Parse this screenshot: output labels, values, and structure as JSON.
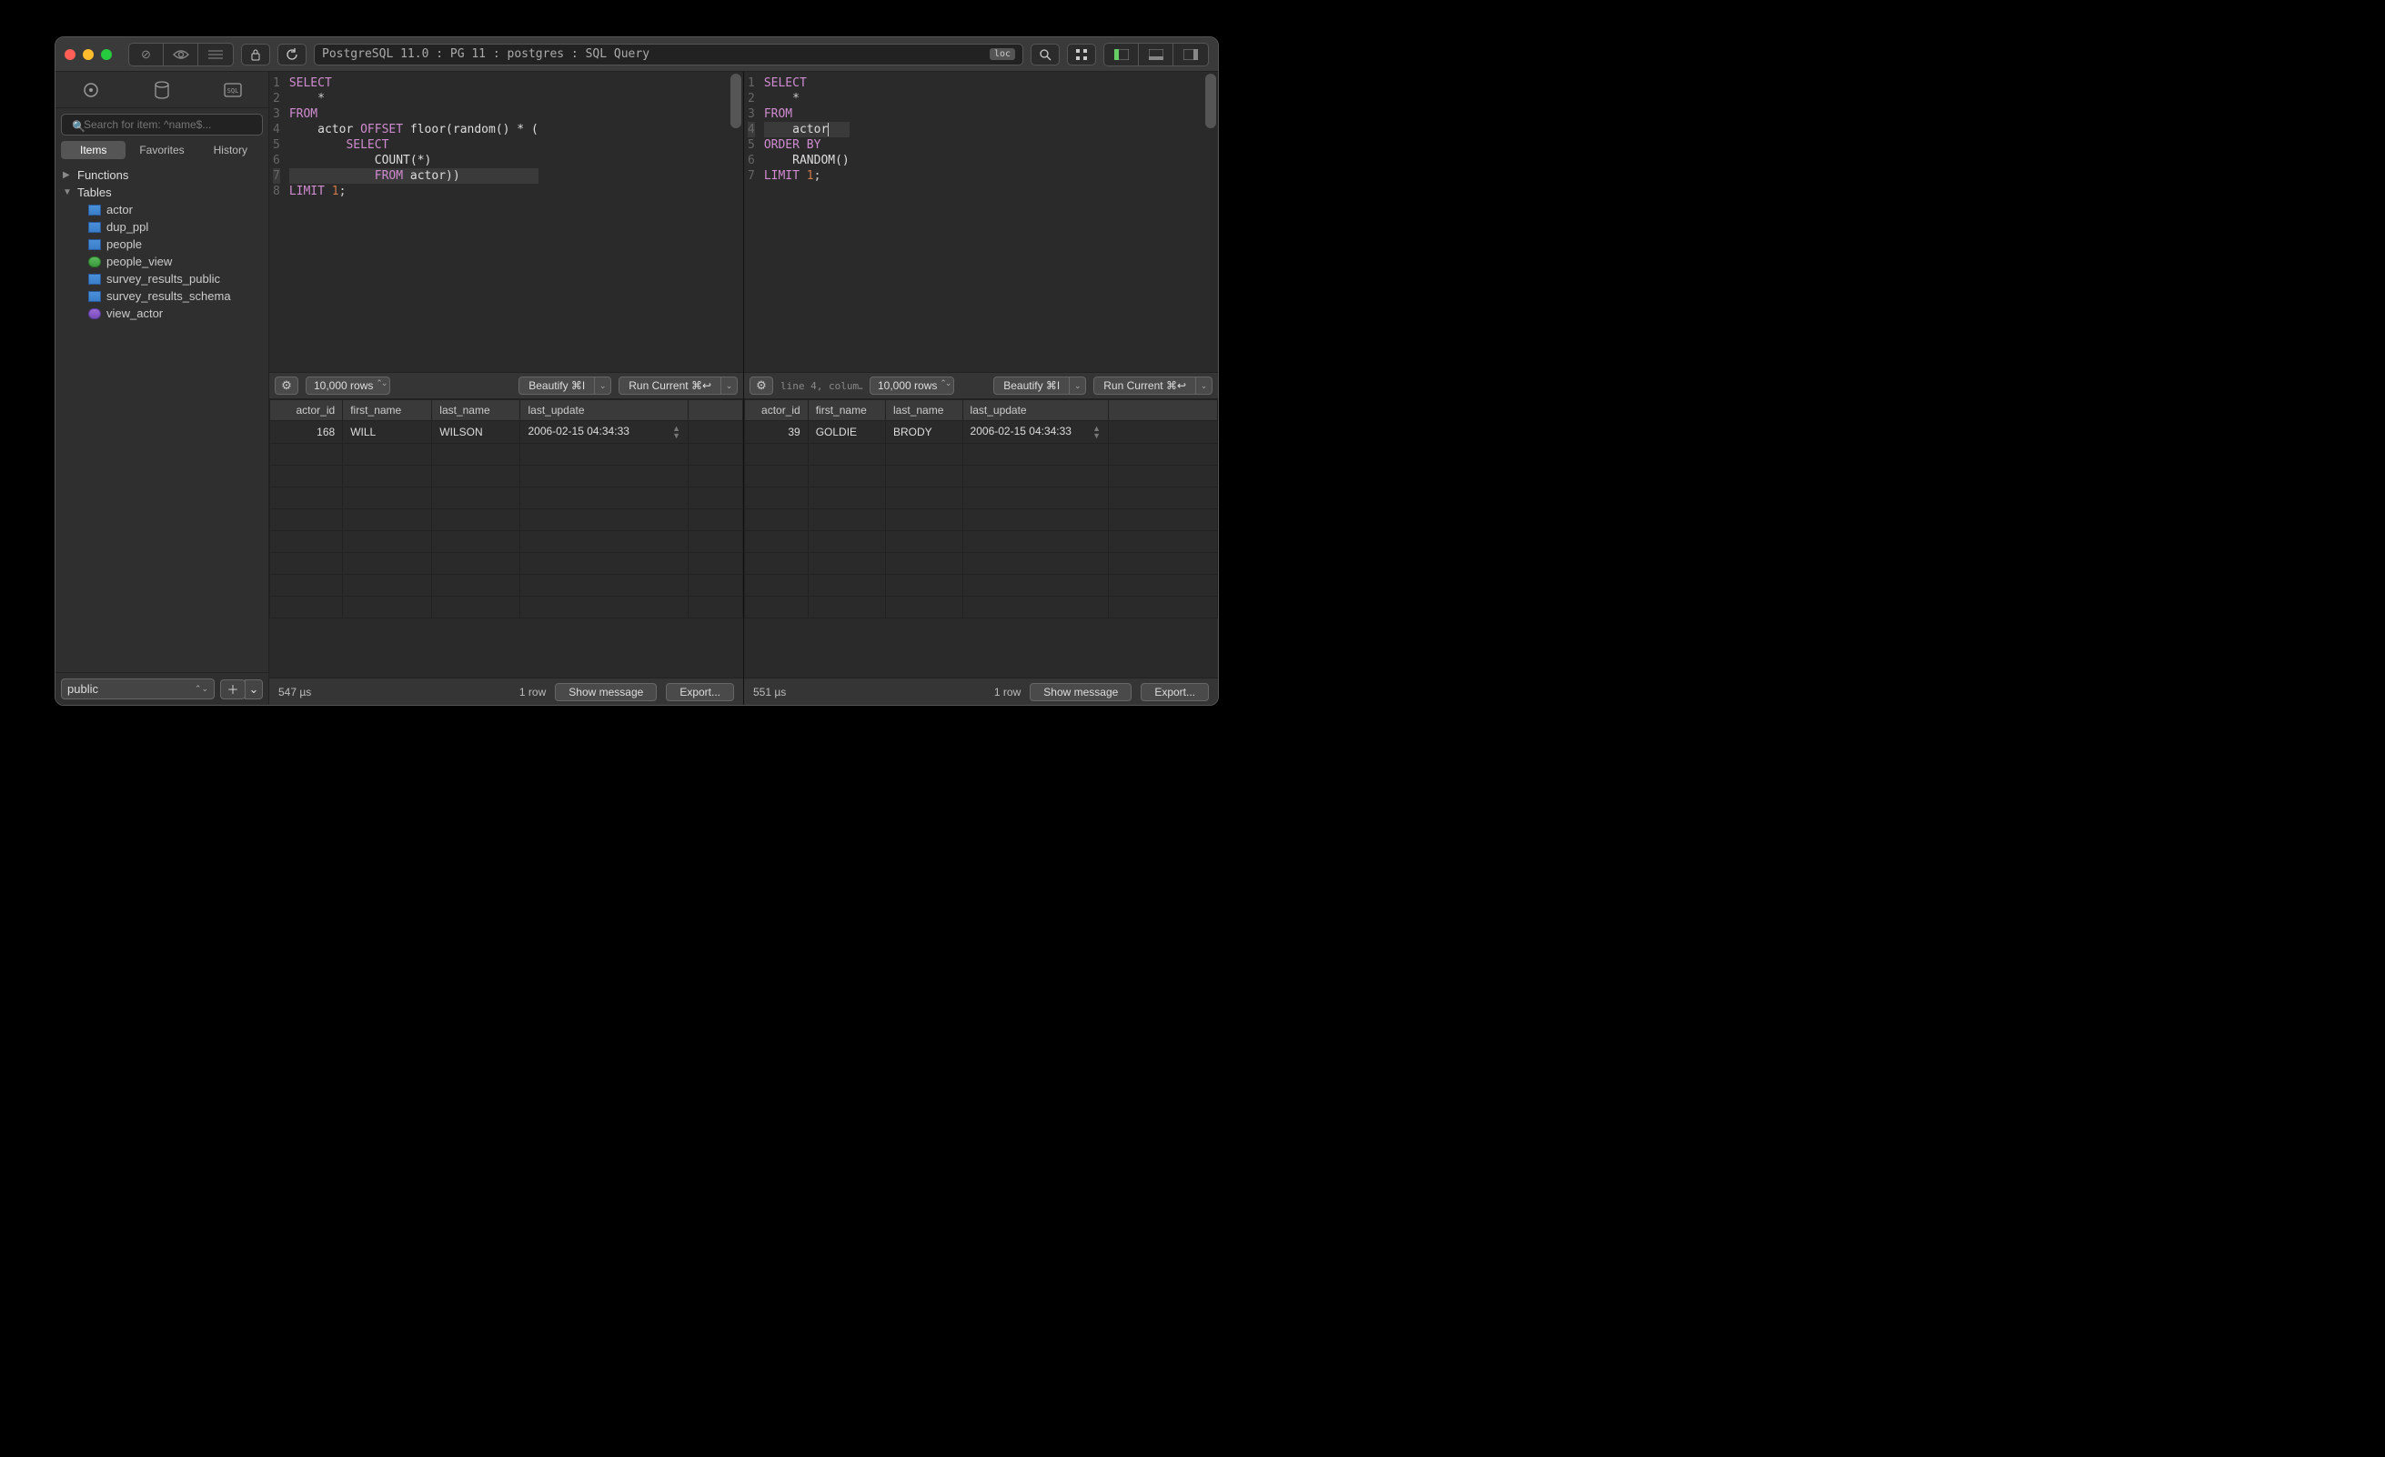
{
  "titlebar": {
    "path": "PostgreSQL 11.0 : PG 11 : postgres : SQL Query",
    "loc_badge": "loc"
  },
  "sidebar": {
    "search_placeholder": "Search for item: ^name$...",
    "tabs": {
      "items": "Items",
      "favorites": "Favorites",
      "history": "History"
    },
    "functions_label": "Functions",
    "tables_label": "Tables",
    "tables": [
      {
        "name": "actor",
        "kind": "blue"
      },
      {
        "name": "dup_ppl",
        "kind": "blue"
      },
      {
        "name": "people",
        "kind": "blue"
      },
      {
        "name": "people_view",
        "kind": "green"
      },
      {
        "name": "survey_results_public",
        "kind": "blue"
      },
      {
        "name": "survey_results_schema",
        "kind": "blue"
      },
      {
        "name": "view_actor",
        "kind": "purple"
      }
    ],
    "schema": "public"
  },
  "left_pane": {
    "rows_limit": "10,000 rows",
    "beautify": "Beautify ⌘I",
    "run": "Run Current ⌘↩",
    "columns": [
      "actor_id",
      "first_name",
      "last_name",
      "last_update"
    ],
    "row": {
      "actor_id": "168",
      "first_name": "WILL",
      "last_name": "WILSON",
      "last_update": "2006-02-15 04:34:33"
    },
    "elapsed": "547 µs",
    "rowcount": "1 row",
    "show_msg": "Show message",
    "export": "Export..."
  },
  "right_pane": {
    "status": "line 4, colum…",
    "rows_limit": "10,000 rows",
    "beautify": "Beautify ⌘I",
    "run": "Run Current ⌘↩",
    "columns": [
      "actor_id",
      "first_name",
      "last_name",
      "last_update"
    ],
    "row": {
      "actor_id": "39",
      "first_name": "GOLDIE",
      "last_name": "BRODY",
      "last_update": "2006-02-15 04:34:33"
    },
    "elapsed": "551 µs",
    "rowcount": "1 row",
    "show_msg": "Show message",
    "export": "Export..."
  }
}
